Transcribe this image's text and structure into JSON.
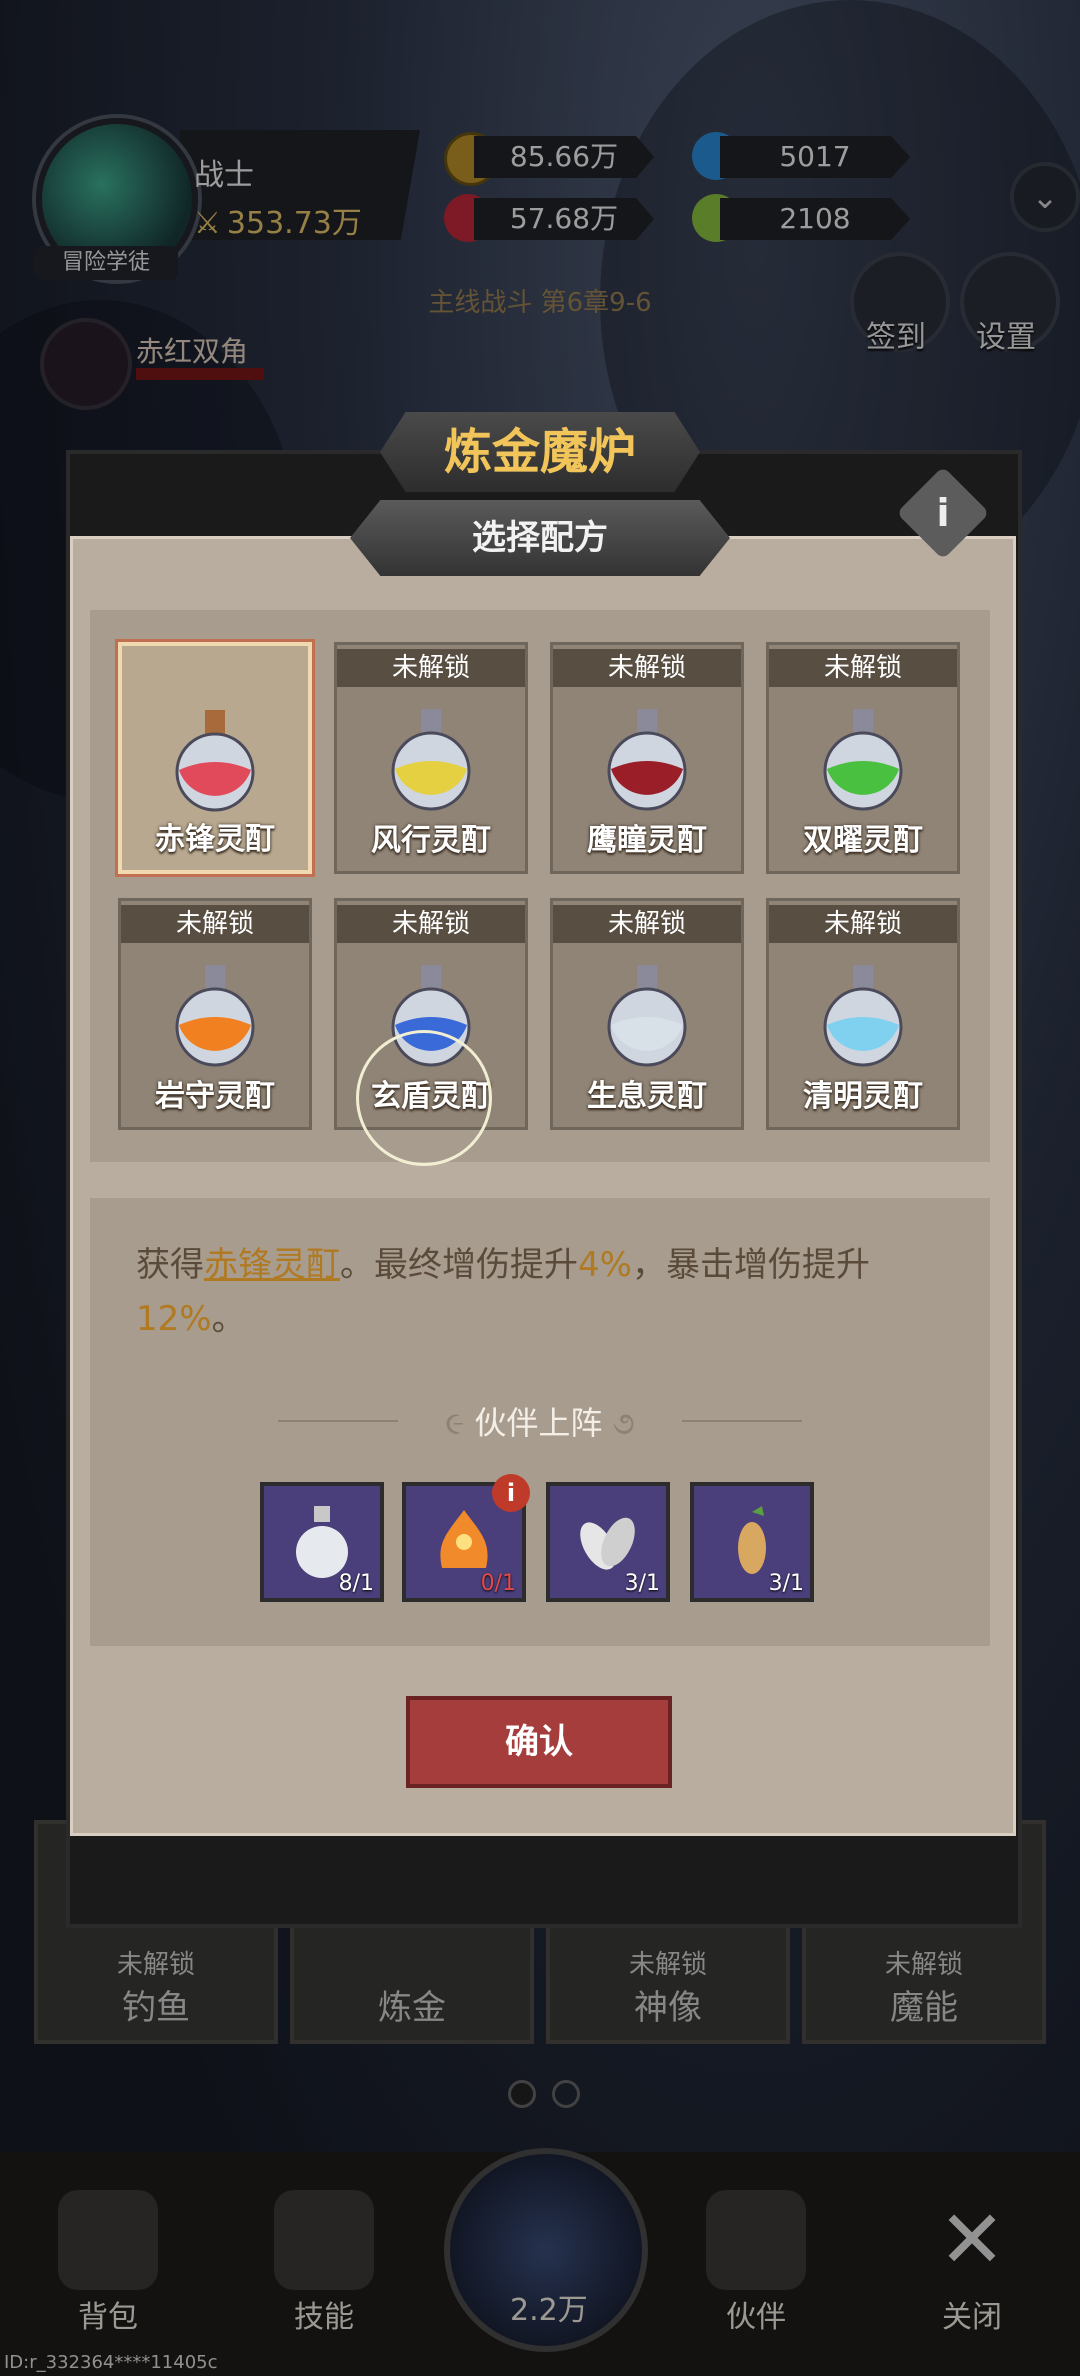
{
  "hero": {
    "name": "战士",
    "power": "353.73万",
    "title_tag": "冒险学徒"
  },
  "resources": {
    "gold": "85.66万",
    "blue_gem": "5017",
    "red_gem": "57.68万",
    "green_item": "2108"
  },
  "enemy": {
    "name": "赤红双角"
  },
  "stage": "主线战斗 第6章9-6",
  "side_buttons": [
    "签到",
    "设置"
  ],
  "modal": {
    "title": "炼金魔炉",
    "subtitle": "选择配方",
    "locked_label": "未解锁",
    "recipes": [
      {
        "name": "赤锋灵酊",
        "locked": false,
        "color": "#e04a5a"
      },
      {
        "name": "风行灵酊",
        "locked": true,
        "color": "#e4d040"
      },
      {
        "name": "鹰瞳灵酊",
        "locked": true,
        "color": "#9a1e28"
      },
      {
        "name": "双曜灵酊",
        "locked": true,
        "color": "#4ac040"
      },
      {
        "name": "岩守灵酊",
        "locked": true,
        "color": "#f08020"
      },
      {
        "name": "玄盾灵酊",
        "locked": true,
        "color": "#3a6ad8"
      },
      {
        "name": "生息灵酊",
        "locked": true,
        "color": "#d8e0e8"
      },
      {
        "name": "清明灵酊",
        "locked": true,
        "color": "#80d0f0"
      }
    ],
    "description": {
      "prefix": "获得",
      "item": "赤锋灵酊",
      "mid1": "。最终增伤提升",
      "val1": "4%",
      "mid2": "，暴击增伤提升",
      "val2": "12%",
      "suffix": "。"
    },
    "partner_title": "伙伴上阵",
    "materials": [
      {
        "name": "empty-flask",
        "count": "8/1"
      },
      {
        "name": "flame-flower",
        "count": "0/1",
        "badge": "i"
      },
      {
        "name": "silver-leaves",
        "count": "3/1"
      },
      {
        "name": "mandrake-root",
        "count": "3/1"
      }
    ],
    "confirm_label": "确认",
    "info_label": "i"
  },
  "functions": [
    {
      "lock": "未解锁",
      "name": "钓鱼"
    },
    {
      "lock": "",
      "name": "炼金"
    },
    {
      "lock": "未解锁",
      "name": "神像"
    },
    {
      "lock": "未解锁",
      "name": "魔能"
    }
  ],
  "nav": {
    "bag": "背包",
    "skills": "技能",
    "fight_power": "2.2万",
    "partners": "伙伴",
    "close": "关闭"
  },
  "id_text": "ID:r_332364****11405c"
}
